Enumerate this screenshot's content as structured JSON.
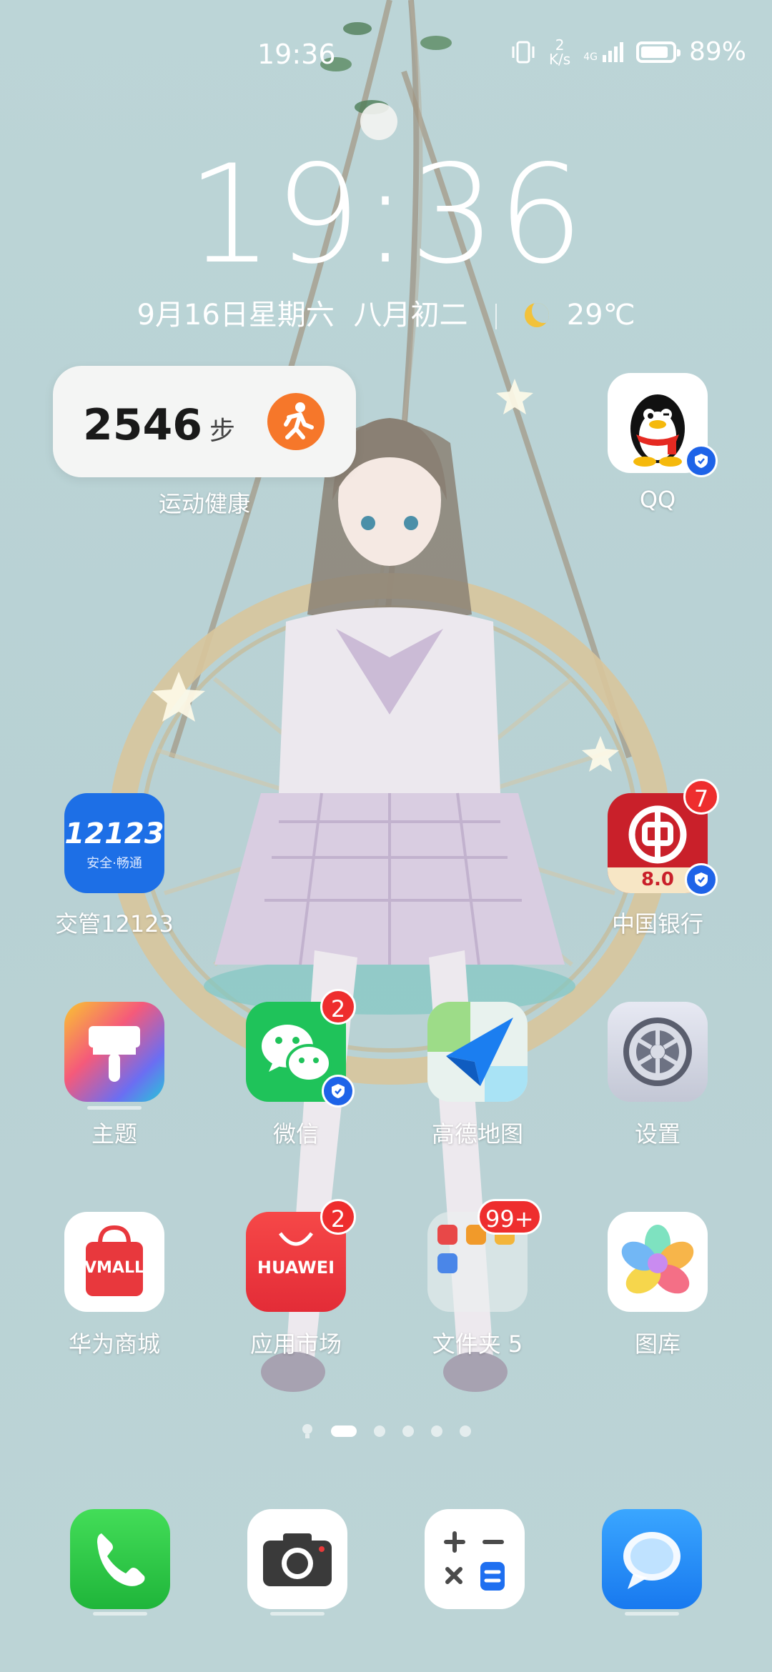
{
  "status_bar": {
    "time": "19:36",
    "net_speed_value": "2",
    "net_speed_unit": "K/s",
    "network": "4G",
    "battery_percent": "89%",
    "battery_level": 0.89
  },
  "lockclock": {
    "time": "19:36",
    "date": "9月16日星期六",
    "lunar_date": "八月初二",
    "weather_temp": "29℃",
    "weather_icon": "moon-icon"
  },
  "health_widget": {
    "steps": "2546",
    "unit": "步",
    "label": "运动健康"
  },
  "apps": {
    "qq": {
      "label": "QQ"
    },
    "traffic": {
      "label": "交管12123",
      "icon_text": "12123",
      "icon_sub": "安全·畅通"
    },
    "bank": {
      "label": "中国银行",
      "badge": "7",
      "icon_text": "8.0"
    },
    "theme": {
      "label": "主题"
    },
    "wechat": {
      "label": "微信",
      "badge": "2"
    },
    "amap": {
      "label": "高德地图"
    },
    "settings": {
      "label": "设置"
    },
    "vmall": {
      "label": "华为商城",
      "icon_text": "VMALL"
    },
    "appmarket": {
      "label": "应用市场",
      "badge": "2",
      "icon_text": "HUAWEI"
    },
    "folder": {
      "label": "文件夹 5",
      "badge": "99+"
    },
    "gallery": {
      "label": "图库"
    }
  },
  "dock": {
    "phone": "phone-icon",
    "camera": "camera-icon",
    "calculator": "calculator-icon",
    "messages": "messages-icon"
  },
  "colors": {
    "badge": "#ee2e2e",
    "shield": "#1e63e8",
    "wechat": "#1fc35a",
    "phone": "#24c53d",
    "messages": "#1e8ff7"
  }
}
